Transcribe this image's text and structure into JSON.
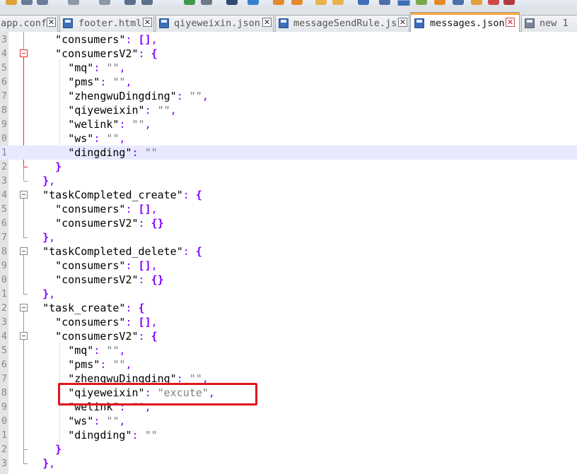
{
  "tabs": [
    {
      "label": "app.conf",
      "icon": "file-icon",
      "active": false
    },
    {
      "label": "footer.html",
      "icon": "file-icon",
      "active": false
    },
    {
      "label": "qiyeweixin.json",
      "icon": "file-icon",
      "active": false
    },
    {
      "label": "messageSendRule.js",
      "icon": "file-icon",
      "active": false
    },
    {
      "label": "messages.json",
      "icon": "file-icon",
      "active": true
    },
    {
      "label": "new 1",
      "icon": "file-icon",
      "active": false
    }
  ],
  "tab_close_glyph": "✕",
  "colors": {
    "active_tab_accent": "#f8a93a",
    "string": "#808080",
    "punctuation": "#8000ff",
    "current_line": "#e8e8ff",
    "annotation_box": "#e0141e"
  },
  "editor": {
    "lines": [
      {
        "num": "3",
        "code": "    \"consumers\": [],"
      },
      {
        "num": "4",
        "code": "    \"consumersV2\": {"
      },
      {
        "num": "5",
        "code": "      \"mq\": \"\","
      },
      {
        "num": "6",
        "code": "      \"pms\": \"\","
      },
      {
        "num": "7",
        "code": "      \"zhengwuDingding\": \"\","
      },
      {
        "num": "8",
        "code": "      \"qiyeweixin\": \"\","
      },
      {
        "num": "9",
        "code": "      \"welink\": \"\","
      },
      {
        "num": "0",
        "code": "      \"ws\": \"\","
      },
      {
        "num": "1",
        "code": "      \"dingding\": \"\""
      },
      {
        "num": "2",
        "code": "    }"
      },
      {
        "num": "3",
        "code": "  },"
      },
      {
        "num": "4",
        "code": "  \"taskCompleted_create\": {"
      },
      {
        "num": "5",
        "code": "    \"consumers\": [],"
      },
      {
        "num": "6",
        "code": "    \"consumersV2\": {}"
      },
      {
        "num": "7",
        "code": "  },"
      },
      {
        "num": "8",
        "code": "  \"taskCompleted_delete\": {"
      },
      {
        "num": "9",
        "code": "    \"consumers\": [],"
      },
      {
        "num": "0",
        "code": "    \"consumersV2\": {}"
      },
      {
        "num": "1",
        "code": "  },"
      },
      {
        "num": "2",
        "code": "  \"task_create\": {"
      },
      {
        "num": "3",
        "code": "    \"consumers\": [],"
      },
      {
        "num": "4",
        "code": "    \"consumersV2\": {"
      },
      {
        "num": "5",
        "code": "      \"mq\": \"\","
      },
      {
        "num": "6",
        "code": "      \"pms\": \"\","
      },
      {
        "num": "7",
        "code": "      \"zhengwuDingding\": \"\","
      },
      {
        "num": "8",
        "code": "      \"qiyeweixin\": \"excute\","
      },
      {
        "num": "9",
        "code": "      \"welink\": \"\","
      },
      {
        "num": "0",
        "code": "      \"ws\": \"\","
      },
      {
        "num": "1",
        "code": "      \"dingding\": \"\""
      },
      {
        "num": "2",
        "code": "    }"
      },
      {
        "num": "3",
        "code": "  },"
      }
    ],
    "current_line_index": 8,
    "highlighted_line_index": 25
  }
}
